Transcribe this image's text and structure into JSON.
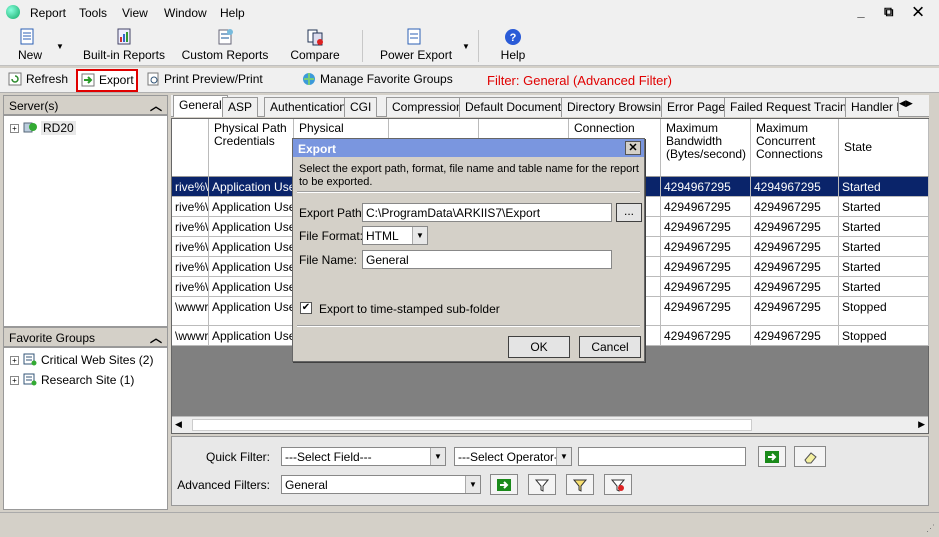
{
  "menubar": {
    "items": [
      "Report",
      "Tools",
      "View",
      "Window",
      "Help"
    ],
    "window_controls": "_ ⧉ ✕"
  },
  "toolbar": {
    "new_label": "New",
    "builtin_reports_label": "Built-in Reports",
    "custom_reports_label": "Custom Reports",
    "compare_label": "Compare",
    "power_export_label": "Power Export",
    "help_label": "Help"
  },
  "actionbar": {
    "refresh_label": "Refresh",
    "export_label": "Export",
    "print_preview_label": "Print Preview/Print",
    "manage_groups_label": "Manage Favorite Groups",
    "filter_label": "Filter: General (Advanced Filter)"
  },
  "servers": {
    "title": "Server(s)",
    "items": [
      {
        "label": "RD20"
      }
    ]
  },
  "favorites": {
    "title": "Favorite Groups",
    "items": [
      {
        "label": "Critical Web Sites (2)"
      },
      {
        "label": "Research Site (1)"
      }
    ]
  },
  "tabs": [
    "General",
    "ASP",
    "Authentication",
    "CGI",
    "Compression",
    "Default Documents",
    "Directory Browsing",
    "Error Page",
    "Failed Request Tracing",
    "Handler M"
  ],
  "grid": {
    "headers": {
      "physical_path_credentials": "Physical Path Credentials",
      "physical_partial": "Physical",
      "connection_partial": "Connection",
      "max_bandwidth": "Maximum Bandwidth (Bytes/second)",
      "max_connections": "Maximum Concurrent Connections",
      "state": "State"
    },
    "rows": [
      {
        "path": "rive%\\ir",
        "credentials": "Application User",
        "bandwidth": "4294967295",
        "connections": "4294967295",
        "state": "Started"
      },
      {
        "path": "rive%\\ir",
        "credentials": "Application User",
        "bandwidth": "4294967295",
        "connections": "4294967295",
        "state": "Started"
      },
      {
        "path": "rive%\\ir",
        "credentials": "Application User",
        "bandwidth": "4294967295",
        "connections": "4294967295",
        "state": "Started"
      },
      {
        "path": "rive%\\ir",
        "credentials": "Application User",
        "bandwidth": "4294967295",
        "connections": "4294967295",
        "state": "Started"
      },
      {
        "path": "rive%\\ir",
        "credentials": "Application User",
        "bandwidth": "4294967295",
        "connections": "4294967295",
        "state": "Started"
      },
      {
        "path": "rive%\\ir",
        "credentials": "Application User",
        "bandwidth": "4294967295",
        "connections": "4294967295",
        "state": "Started"
      },
      {
        "path": "\\wwwrc",
        "credentials": "Application User",
        "bandwidth": "4294967295",
        "connections": "4294967295",
        "state": "Stopped"
      },
      {
        "path": "\\wwwrc",
        "credentials": "Application User",
        "bandwidth": "4294967295",
        "connections": "4294967295",
        "state": "Stopped"
      }
    ]
  },
  "filters": {
    "quick_filter_label": "Quick Filter:",
    "select_field": "---Select Field---",
    "select_operator": "---Select Operator---",
    "quick_value": "",
    "advanced_label": "Advanced Filters:",
    "advanced_value": "General"
  },
  "dialog": {
    "title": "Export",
    "description": "Select the export path, format, file name and table name for the report to be exported.",
    "path_label": "Export Path:",
    "path_value": "C:\\ProgramData\\ARKIIS7\\Export",
    "browse_label": "...",
    "format_label": "File Format:",
    "format_value": "HTML",
    "name_label": "File Name:",
    "name_value": "General",
    "timestamp_label": "Export to time-stamped sub-folder",
    "timestamp_checked": true,
    "ok_label": "OK",
    "cancel_label": "Cancel"
  },
  "colors": {
    "accent_red": "#e00000",
    "selection": "#0a246a",
    "title_bar": "#7a96df"
  }
}
